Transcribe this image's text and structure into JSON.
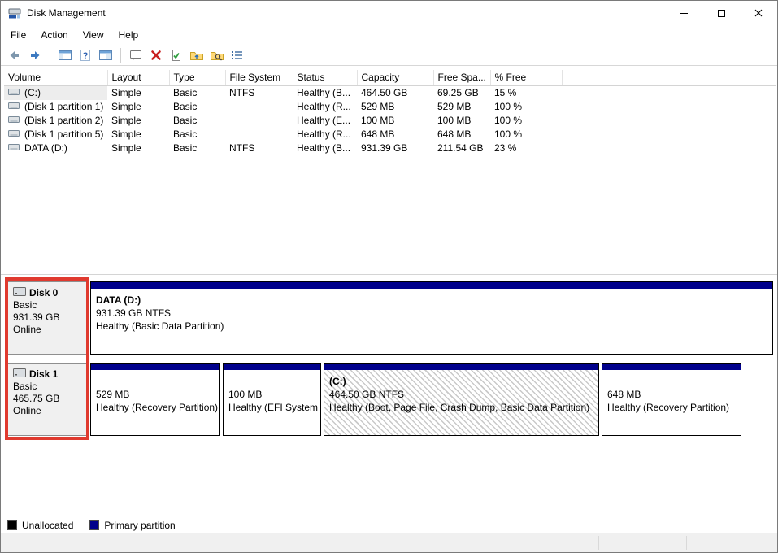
{
  "window": {
    "title": "Disk Management"
  },
  "menu": {
    "items": [
      "File",
      "Action",
      "View",
      "Help"
    ]
  },
  "toolbar": {
    "icons": [
      "back",
      "forward",
      "console-tree",
      "help",
      "details-pane",
      "action-dialog",
      "delete",
      "check-document",
      "folder-up",
      "folder-search",
      "list-view"
    ]
  },
  "volume_table": {
    "columns": [
      "Volume",
      "Layout",
      "Type",
      "File System",
      "Status",
      "Capacity",
      "Free Spa...",
      "% Free"
    ],
    "rows": [
      {
        "volume": "(C:)",
        "layout": "Simple",
        "type": "Basic",
        "fs": "NTFS",
        "status": "Healthy (B...",
        "capacity": "464.50 GB",
        "free": "69.25 GB",
        "pct": "15 %"
      },
      {
        "volume": "(Disk 1 partition 1)",
        "layout": "Simple",
        "type": "Basic",
        "fs": "",
        "status": "Healthy (R...",
        "capacity": "529 MB",
        "free": "529 MB",
        "pct": "100 %"
      },
      {
        "volume": "(Disk 1 partition 2)",
        "layout": "Simple",
        "type": "Basic",
        "fs": "",
        "status": "Healthy (E...",
        "capacity": "100 MB",
        "free": "100 MB",
        "pct": "100 %"
      },
      {
        "volume": "(Disk 1 partition 5)",
        "layout": "Simple",
        "type": "Basic",
        "fs": "",
        "status": "Healthy (R...",
        "capacity": "648 MB",
        "free": "648 MB",
        "pct": "100 %"
      },
      {
        "volume": "DATA (D:)",
        "layout": "Simple",
        "type": "Basic",
        "fs": "NTFS",
        "status": "Healthy (B...",
        "capacity": "931.39 GB",
        "free": "211.54 GB",
        "pct": "23 %"
      }
    ]
  },
  "disk_groups": [
    {
      "name": "Disk 0",
      "kind": "Basic",
      "size": "931.39 GB",
      "status": "Online",
      "partitions": [
        {
          "name": "DATA  (D:)",
          "size": "931.39 GB NTFS",
          "status": "Healthy (Basic Data Partition)"
        }
      ]
    },
    {
      "name": "Disk 1",
      "kind": "Basic",
      "size": "465.75 GB",
      "status": "Online",
      "partitions": [
        {
          "name": "",
          "size": "529 MB",
          "status": "Healthy (Recovery Partition)"
        },
        {
          "name": "",
          "size": "100 MB",
          "status": "Healthy (EFI System"
        },
        {
          "name": "(C:)",
          "size": "464.50 GB NTFS",
          "status": "Healthy (Boot, Page File, Crash Dump, Basic Data Partition)"
        },
        {
          "name": "",
          "size": "648 MB",
          "status": "Healthy (Recovery Partition)"
        }
      ]
    }
  ],
  "legend": {
    "items": [
      {
        "label": "Unallocated",
        "color": "#000000"
      },
      {
        "label": "Primary partition",
        "color": "#00008b"
      }
    ]
  },
  "colors": {
    "primary_partition": "#00008b",
    "annotation_red": "#e03a2f",
    "disk_header_bg": "#f0f0f0"
  }
}
